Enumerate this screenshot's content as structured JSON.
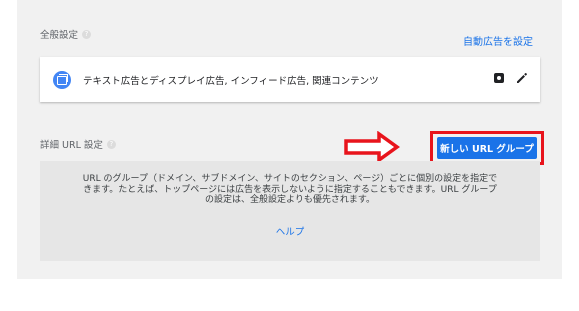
{
  "general_settings": {
    "title": "全般設定",
    "help_glyph": "?",
    "auto_ads_link": "自動広告を設定",
    "card_text": "テキスト広告とディスプレイ広告, インフィード広告, 関連コンテンツ",
    "icons": [
      "ad-format-icon",
      "preview-icon",
      "edit-icon"
    ]
  },
  "url_settings": {
    "title": "詳細 URL 設定",
    "help_glyph": "?",
    "new_group_button": "新しい URL グループ",
    "info_text": "URL のグループ（ドメイン、サブドメイン、サイトのセクション、ページ）ごとに個別の設定を指定できます。たとえば、トップページには広告を表示しないように指定することもできます。URL グループの設定は、全般設定よりも優先されます。",
    "help_link": "ヘルプ"
  },
  "colors": {
    "accent": "#1a73e8",
    "highlight": "#e8141c",
    "panel": "#f1f1f1"
  }
}
